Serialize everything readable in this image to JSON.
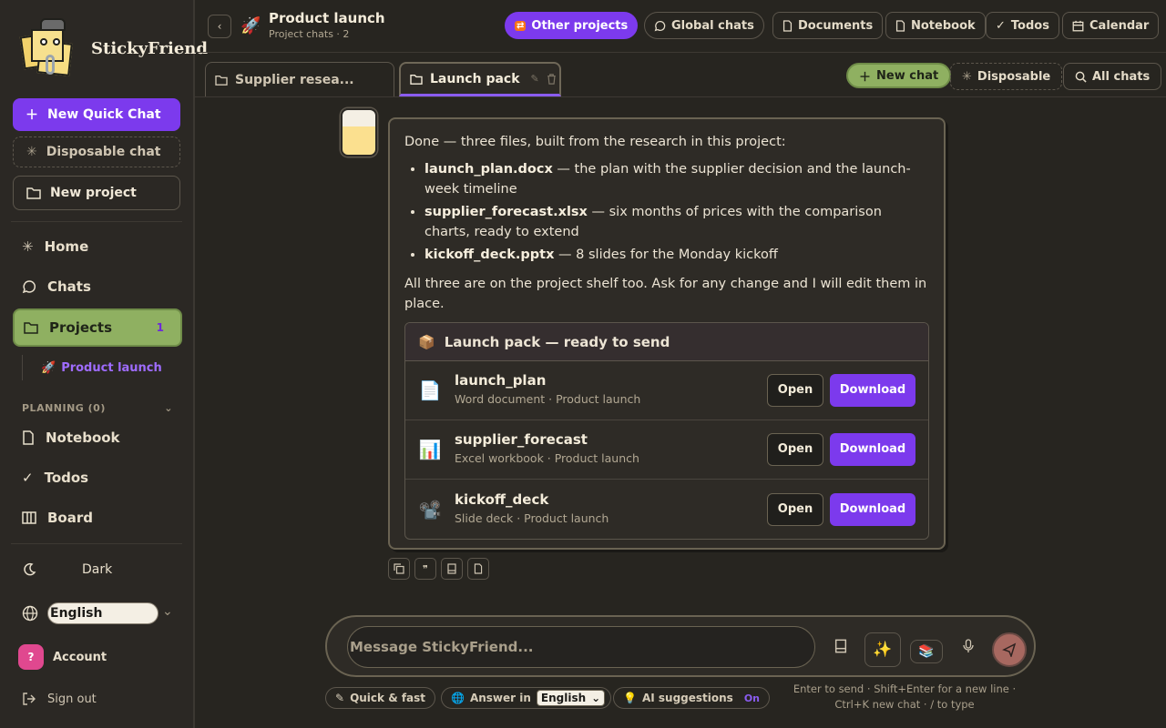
{
  "app": {
    "name": "StickyFriend"
  },
  "sidebar": {
    "new_quick_chat": "New Quick Chat",
    "disposable_chat": "Disposable chat",
    "new_project": "New project",
    "nav": [
      {
        "label": "Home"
      },
      {
        "label": "Chats"
      },
      {
        "label": "Projects",
        "badge": "1"
      }
    ],
    "sub_project": {
      "icon": "🚀",
      "label": "Product launch"
    },
    "planning_label": "PLANNING (0)",
    "planning": [
      {
        "label": "Notebook"
      },
      {
        "label": "Todos"
      },
      {
        "label": "Board"
      }
    ],
    "theme_label": "Dark",
    "language": "English",
    "account_initial": "?",
    "account_label": "Account",
    "sign_out": "Sign out"
  },
  "header": {
    "title": "Product launch",
    "subtitle": "Project chats · 2",
    "buttons": {
      "other_projects": "Other projects",
      "global_chats": "Global chats",
      "documents": "Documents",
      "notebook": "Notebook",
      "todos": "Todos",
      "calendar": "Calendar"
    }
  },
  "tabs": [
    {
      "label": "Supplier resea..."
    },
    {
      "label": "Launch pack"
    }
  ],
  "toolbar": {
    "new_chat": "New chat",
    "disposable": "Disposable",
    "all_chats": "All chats"
  },
  "message": {
    "intro": "Done — three files, built from the research in this project:",
    "items": [
      {
        "file": "launch_plan.docx",
        "desc": " — the plan with the supplier decision and the launch-week timeline"
      },
      {
        "file": "supplier_forecast.xlsx",
        "desc": " — six months of prices with the comparison charts, ready to extend"
      },
      {
        "file": "kickoff_deck.pptx",
        "desc": " — 8 slides for the Monday kickoff"
      }
    ],
    "outro": "All three are on the project shelf too. Ask for any change and I will edit them in place.",
    "pack_title": "Launch pack — ready to send",
    "files": [
      {
        "icon": "📄",
        "name": "launch_plan",
        "sub": "Word document · Product launch",
        "open": "Open",
        "download": "Download"
      },
      {
        "icon": "📊",
        "name": "supplier_forecast",
        "sub": "Excel workbook · Product launch",
        "open": "Open",
        "download": "Download"
      },
      {
        "icon": "📽️",
        "name": "kickoff_deck",
        "sub": "Slide deck · Product launch",
        "open": "Open",
        "download": "Download"
      }
    ]
  },
  "composer": {
    "placeholder": "Message StickyFriend...",
    "quick_fast": "Quick & fast",
    "answer_in": "Answer in",
    "answer_lang": "English",
    "ai_suggestions": "AI suggestions",
    "ai_state": "On",
    "hint": "Enter to send · Shift+Enter for a new line · Ctrl+K new chat · / to type"
  },
  "colors": {
    "accent": "#7c3aed",
    "active_nav": "#8fb061",
    "background": "#272520"
  }
}
